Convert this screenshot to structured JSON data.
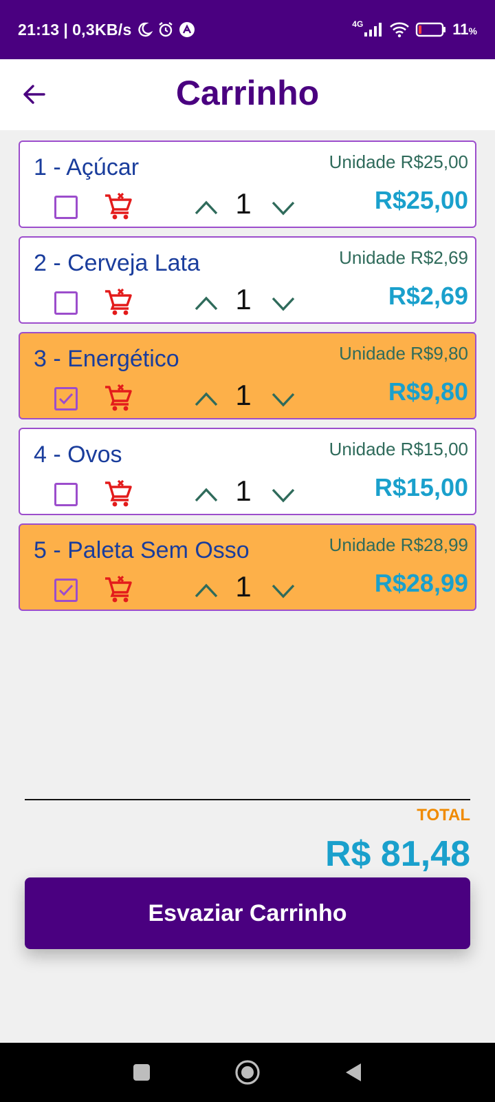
{
  "status_bar": {
    "time": "21:13",
    "speed": "0,3KB/s",
    "network": "4G",
    "battery": "11",
    "battery_unit": "%"
  },
  "header": {
    "title": "Carrinho",
    "back_icon": "arrow-left-icon"
  },
  "colors": {
    "primary": "#4a0080",
    "selected_item_bg": "#fdb049",
    "item_border": "#9c4dcc",
    "price_accent": "#1aa0cc",
    "total_label": "#f08a00",
    "remove_icon": "#e31b1b"
  },
  "cart": {
    "items": [
      {
        "name": "1 - Açúcar",
        "unit_price": "Unidade R$25,00",
        "quantity": "1",
        "total": "R$25,00",
        "checked": false
      },
      {
        "name": "2 - Cerveja Lata",
        "unit_price": "Unidade R$2,69",
        "quantity": "1",
        "total": "R$2,69",
        "checked": false
      },
      {
        "name": "3 - Energético",
        "unit_price": "Unidade R$9,80",
        "quantity": "1",
        "total": "R$9,80",
        "checked": true
      },
      {
        "name": "4 - Ovos",
        "unit_price": "Unidade R$15,00",
        "quantity": "1",
        "total": "R$15,00",
        "checked": false
      },
      {
        "name": "5 - Paleta Sem Osso",
        "unit_price": "Unidade R$28,99",
        "quantity": "1",
        "total": "R$28,99",
        "checked": true
      }
    ]
  },
  "summary": {
    "total_label": "TOTAL",
    "total_value": "R$ 81,48"
  },
  "actions": {
    "empty_cart_label": "Esvaziar Carrinho"
  },
  "nav_bar": {
    "icons": [
      "recents-square-icon",
      "home-circle-icon",
      "back-triangle-icon"
    ]
  }
}
